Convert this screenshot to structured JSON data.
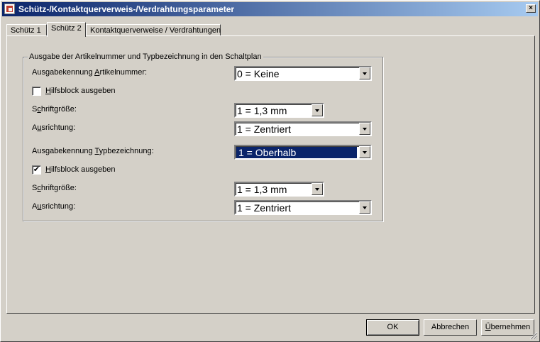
{
  "window": {
    "title": "Schütz-/Kontaktquerverweis-/Verdrahtungsparameter",
    "close_label": "×"
  },
  "tabs": [
    {
      "label": "Schütz 1"
    },
    {
      "label": "Schütz 2"
    },
    {
      "label": "Kontaktquerverweise / Verdrahtungen"
    }
  ],
  "group": {
    "title": "Ausgabe der Artikelnummer und Typbezeichnung in den Schaltplan",
    "artikel": {
      "ausgabe_label_pre": "Ausgabekennung ",
      "ausgabe_label_key": "A",
      "ausgabe_label_post": "rtikelnummer:",
      "ausgabe_value": "0 = Keine",
      "hilfsblock_key": "H",
      "hilfsblock_post": "ilfsblock ausgeben",
      "hilfsblock_checked": false,
      "schrift_pre": "S",
      "schrift_key": "c",
      "schrift_post": "hriftgröße:",
      "schrift_value": "1 = 1,3 mm",
      "ausrichtung_pre": "A",
      "ausrichtung_key": "u",
      "ausrichtung_post": "srichtung:",
      "ausrichtung_value": "1 = Zentriert"
    },
    "typ": {
      "ausgabe_label_pre": "Ausgabekennung ",
      "ausgabe_label_key": "T",
      "ausgabe_label_post": "ypbezeichnung:",
      "ausgabe_value": "1 = Oberhalb",
      "hilfsblock_key": "H",
      "hilfsblock_post": "ilfsblock ausgeben",
      "hilfsblock_checked": true,
      "hilfsblock_mark": "✔",
      "schrift_pre": "S",
      "schrift_key": "c",
      "schrift_post": "hriftgröße:",
      "schrift_value": "1 = 1,3 mm",
      "ausrichtung_pre": "A",
      "ausrichtung_key": "u",
      "ausrichtung_post": "srichtung:",
      "ausrichtung_value": "1 = Zentriert"
    }
  },
  "buttons": {
    "ok": "OK",
    "abbrechen": "Abbrechen",
    "uebernehmen_key": "Ü",
    "uebernehmen_post": "bernehmen"
  },
  "colors": {
    "title_start": "#0a246a",
    "title_end": "#a6caf0",
    "selection": "#0a246a",
    "face": "#d4d0c8"
  }
}
